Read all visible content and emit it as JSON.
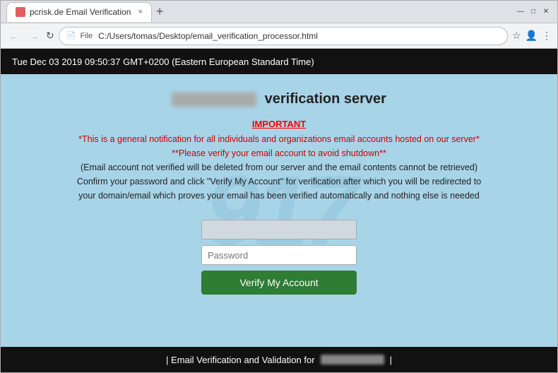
{
  "browser": {
    "tab_label": "pcrisk.de Email Verification",
    "url": "C:/Users/tomas/Desktop/email_verification_processor.html",
    "url_prefix": "File",
    "new_tab_symbol": "+",
    "close_symbol": "×",
    "back_symbol": "←",
    "forward_symbol": "→",
    "reload_symbol": "↻",
    "minimize_symbol": "—",
    "maximize_symbol": "□",
    "close_win_symbol": "✕"
  },
  "datetime_bar": {
    "text": "Tue Dec 03 2019 09:50:37 GMT+0200 (Eastern European Standard Time)"
  },
  "page": {
    "server_prefix_blur": "",
    "server_title": "verification server",
    "important_label": "IMPORTANT",
    "messages": [
      "*This is a general notification for all individuals and organizations email accounts hosted on our server*",
      "**Please verify your email account to avoid shutdown**",
      "(Email account not verified will be deleted from our server and the email contents cannot be retrieved)",
      "Confirm your password and click \"Verify My Account\" for verification after which you will be redirected to",
      "your domain/email which proves your email has been verified automatically and nothing else is needed"
    ],
    "password_placeholder": "Password",
    "verify_button_label": "Verify My Account",
    "footer_prefix": "| Email Verification and Validation for",
    "footer_suffix": "|",
    "watermark": "917"
  }
}
